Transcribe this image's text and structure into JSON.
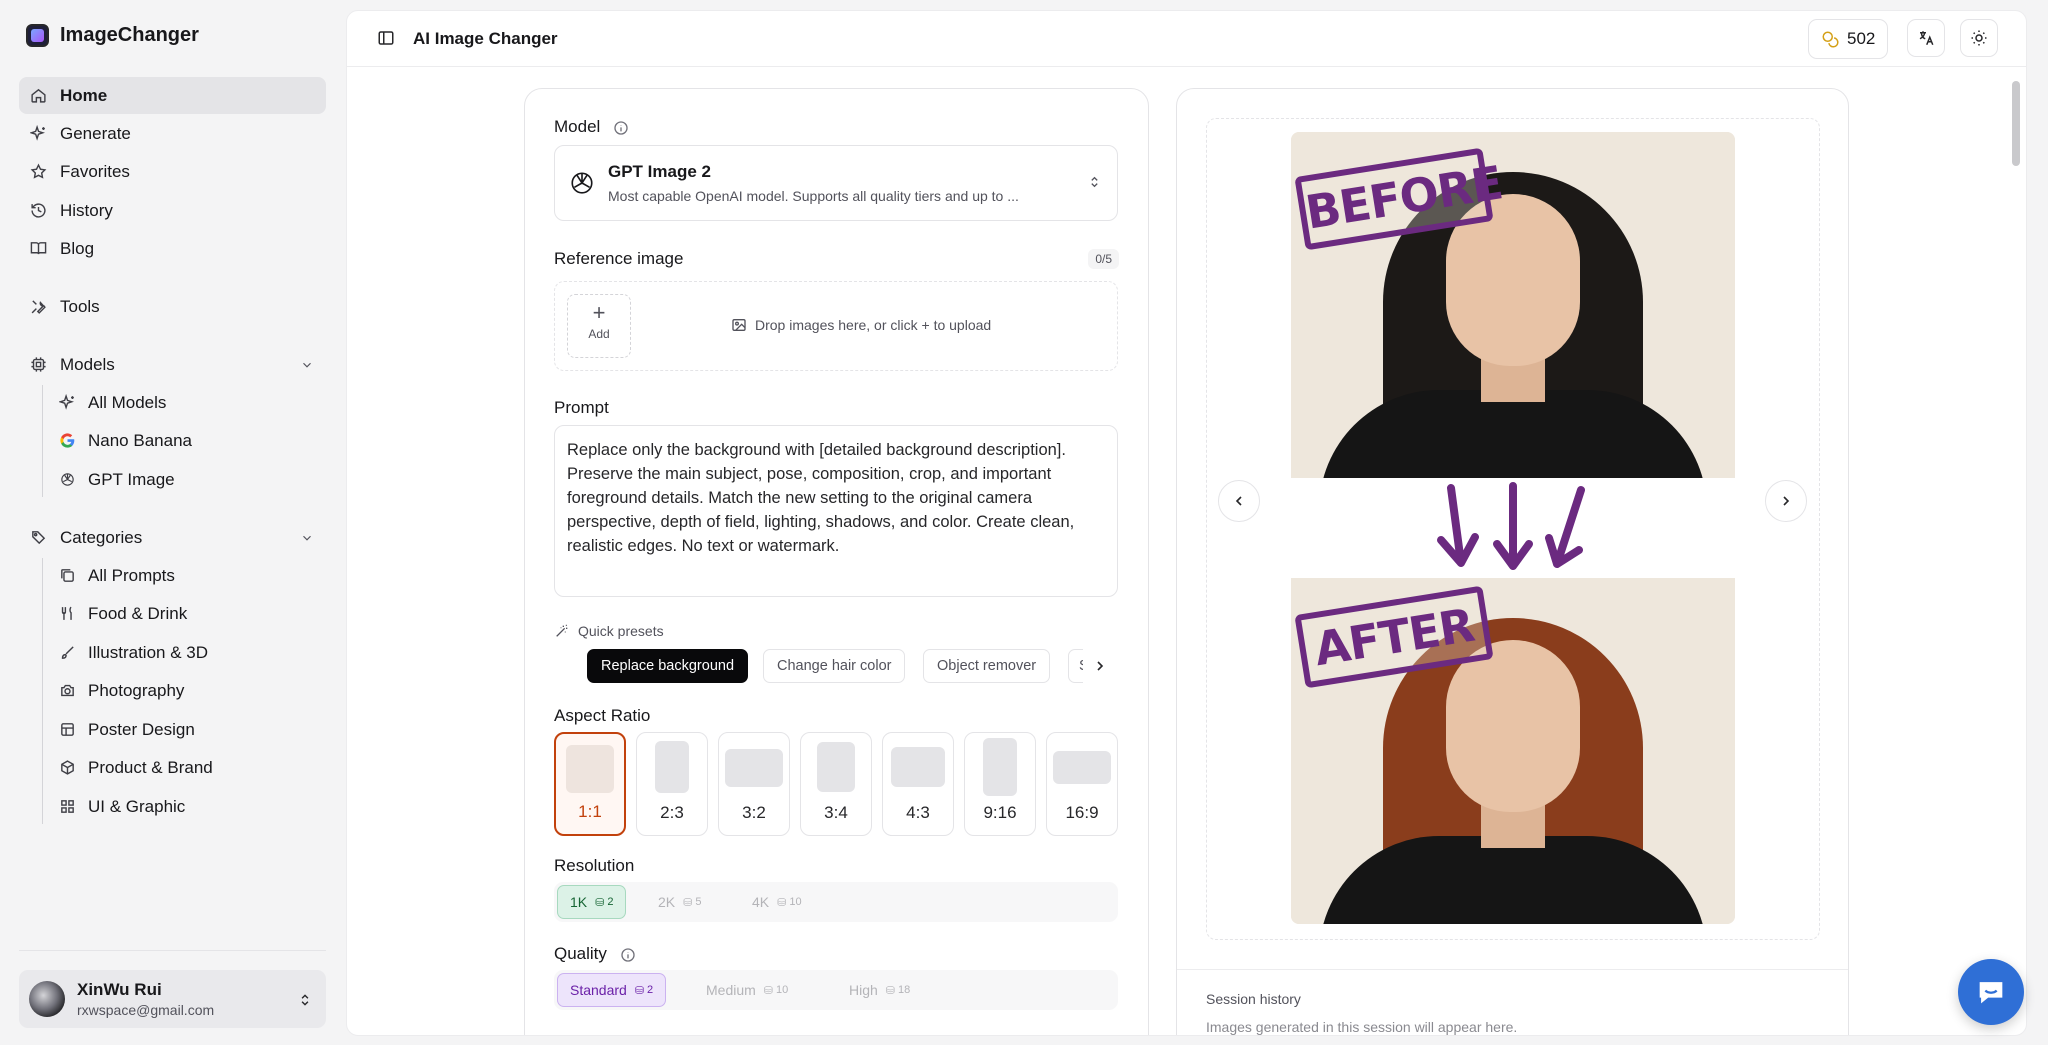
{
  "app": {
    "name": "ImageChanger"
  },
  "sidebar": {
    "items": [
      {
        "label": "Home",
        "icon": "home-icon"
      },
      {
        "label": "Generate",
        "icon": "sparkles-icon"
      },
      {
        "label": "Favorites",
        "icon": "star-icon"
      },
      {
        "label": "History",
        "icon": "history-icon"
      },
      {
        "label": "Blog",
        "icon": "book-icon"
      },
      {
        "label": "Tools",
        "icon": "tools-icon"
      }
    ],
    "models": {
      "label": "Models",
      "items": [
        {
          "label": "All Models",
          "icon": "sparkles-icon"
        },
        {
          "label": "Nano Banana",
          "icon": "google-icon"
        },
        {
          "label": "GPT Image",
          "icon": "openai-icon"
        }
      ]
    },
    "categories": {
      "label": "Categories",
      "items": [
        {
          "label": "All Prompts",
          "icon": "gallery-icon"
        },
        {
          "label": "Food & Drink",
          "icon": "utensils-icon"
        },
        {
          "label": "Illustration & 3D",
          "icon": "brush-icon"
        },
        {
          "label": "Photography",
          "icon": "camera-icon"
        },
        {
          "label": "Poster Design",
          "icon": "layout-icon"
        },
        {
          "label": "Product & Brand",
          "icon": "box-icon"
        },
        {
          "label": "UI & Graphic",
          "icon": "grid-icon"
        }
      ]
    },
    "user": {
      "name": "XinWu Rui",
      "email": "rxwspace@gmail.com"
    }
  },
  "header": {
    "title": "AI Image Changer",
    "credits": "502"
  },
  "form": {
    "model_label": "Model",
    "model": {
      "name": "GPT Image 2",
      "description": "Most capable OpenAI model. Supports all quality tiers and up to ..."
    },
    "reference_label": "Reference image",
    "reference_count": "0/5",
    "add_label": "Add",
    "drop_hint": "Drop images here, or click + to upload",
    "prompt_label": "Prompt",
    "prompt_value": "Replace only the background with [detailed background description]. Preserve the main subject, pose, composition, crop, and important foreground details. Match the new setting to the original camera perspective, depth of field, lighting, shadows, and color. Create clean, realistic edges. No text or watermark.",
    "presets_label": "Quick presets",
    "presets": [
      "Replace background",
      "Change hair color",
      "Object remover",
      "S"
    ],
    "aspect_label": "Aspect Ratio",
    "ratios": [
      "1:1",
      "2:3",
      "3:2",
      "3:4",
      "4:3",
      "9:16",
      "16:9"
    ],
    "selected_ratio": "1:1",
    "resolution_label": "Resolution",
    "resolutions": [
      {
        "label": "1K",
        "cost": "2"
      },
      {
        "label": "2K",
        "cost": "5"
      },
      {
        "label": "4K",
        "cost": "10"
      }
    ],
    "quality_label": "Quality",
    "qualities": [
      {
        "label": "Standard",
        "cost": "2"
      },
      {
        "label": "Medium",
        "cost": "10"
      },
      {
        "label": "High",
        "cost": "18"
      }
    ]
  },
  "preview": {
    "before_label": "BEFORE",
    "after_label": "AFTER",
    "session_title": "Session history",
    "session_hint": "Images generated in this session will appear here."
  },
  "colors": {
    "accent": "#c2410c",
    "stamp": "#6b2a80",
    "chat": "#2f6fd6"
  }
}
